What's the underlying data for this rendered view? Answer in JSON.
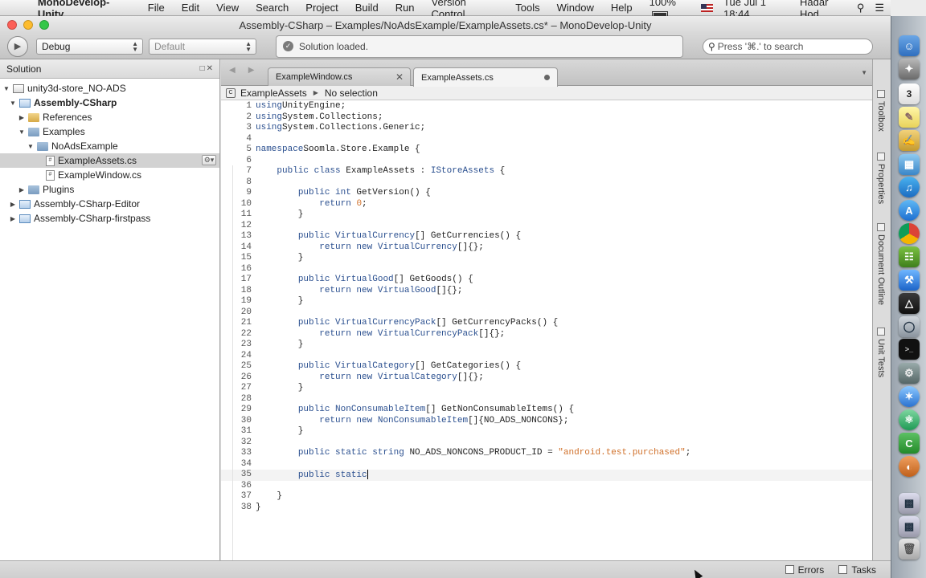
{
  "menubar": {
    "apple_glyph": "",
    "app_name": "MonoDevelop-Unity",
    "menus": [
      "File",
      "Edit",
      "View",
      "Search",
      "Project",
      "Build",
      "Run",
      "Version Control",
      "Tools",
      "Window",
      "Help"
    ],
    "battery": "100%",
    "datetime": "Tue Jul 1  18:44",
    "user": "Hadar Hod"
  },
  "window": {
    "title": "Assembly-CSharp – Examples/NoAdsExample/ExampleAssets.cs* – MonoDevelop-Unity"
  },
  "toolbar": {
    "configuration": "Debug",
    "platform": "Default",
    "status": "Solution loaded.",
    "search_placeholder": "Press '⌘.' to search"
  },
  "solution": {
    "header": "Solution",
    "items": [
      {
        "label": "unity3d-store_NO-ADS",
        "icon": "solution-icon"
      },
      {
        "label": "Assembly-CSharp",
        "icon": "project-icon"
      },
      {
        "label": "References",
        "icon": "references-icon"
      },
      {
        "label": "Examples",
        "icon": "folder-icon"
      },
      {
        "label": "NoAdsExample",
        "icon": "folder-icon"
      },
      {
        "label": "ExampleAssets.cs",
        "icon": "cs-file-icon"
      },
      {
        "label": "ExampleWindow.cs",
        "icon": "cs-file-icon"
      },
      {
        "label": "Plugins",
        "icon": "folder-icon"
      },
      {
        "label": "Assembly-CSharp-Editor",
        "icon": "project-icon"
      },
      {
        "label": "Assembly-CSharp-firstpass",
        "icon": "project-icon"
      }
    ]
  },
  "editor": {
    "tabs": [
      {
        "label": "ExampleWindow.cs"
      },
      {
        "label": "ExampleAssets.cs"
      }
    ],
    "breadcrumb": {
      "class_name": "ExampleAssets",
      "member": "No selection"
    }
  },
  "side_pads": [
    "Toolbox",
    "Properties",
    "Document Outline",
    "Unit Tests"
  ],
  "statusbar": {
    "errors": "Errors",
    "tasks": "Tasks"
  },
  "code_lines": [
    [
      [
        "kw",
        "using"
      ],
      [
        "",
        "UnityEngine;"
      ]
    ],
    [
      [
        "kw",
        "using"
      ],
      [
        "",
        "System.Collections;"
      ]
    ],
    [
      [
        "kw",
        "using"
      ],
      [
        "",
        "System.Collections.Generic;"
      ]
    ],
    [],
    [
      [
        "kw",
        "namespace"
      ],
      [
        "",
        "Soomla.Store.Example {"
      ]
    ],
    [],
    [
      [
        "",
        "    "
      ],
      [
        "kw",
        "public class"
      ],
      [
        "",
        " ExampleAssets : "
      ],
      [
        "ty",
        "IStoreAssets"
      ],
      [
        "",
        " {"
      ]
    ],
    [],
    [
      [
        "",
        "        "
      ],
      [
        "kw",
        "public int"
      ],
      [
        "",
        " GetVersion() {"
      ]
    ],
    [
      [
        "",
        "            "
      ],
      [
        "kw",
        "return"
      ],
      [
        "",
        " "
      ],
      [
        "num",
        "0"
      ],
      [
        "",
        ";"
      ]
    ],
    [
      [
        "",
        "        }"
      ]
    ],
    [],
    [
      [
        "",
        "        "
      ],
      [
        "kw",
        "public"
      ],
      [
        "",
        " "
      ],
      [
        "ty",
        "VirtualCurrency"
      ],
      [
        "",
        "[] GetCurrencies() {"
      ]
    ],
    [
      [
        "",
        "            "
      ],
      [
        "kw",
        "return new"
      ],
      [
        "",
        " "
      ],
      [
        "ty",
        "VirtualCurrency"
      ],
      [
        "",
        "[]{};"
      ]
    ],
    [
      [
        "",
        "        }"
      ]
    ],
    [],
    [
      [
        "",
        "        "
      ],
      [
        "kw",
        "public"
      ],
      [
        "",
        " "
      ],
      [
        "ty",
        "VirtualGood"
      ],
      [
        "",
        "[] GetGoods() {"
      ]
    ],
    [
      [
        "",
        "            "
      ],
      [
        "kw",
        "return new"
      ],
      [
        "",
        " "
      ],
      [
        "ty",
        "VirtualGood"
      ],
      [
        "",
        "[]{};"
      ]
    ],
    [
      [
        "",
        "        }"
      ]
    ],
    [],
    [
      [
        "",
        "        "
      ],
      [
        "kw",
        "public"
      ],
      [
        "",
        " "
      ],
      [
        "ty",
        "VirtualCurrencyPack"
      ],
      [
        "",
        "[] GetCurrencyPacks() {"
      ]
    ],
    [
      [
        "",
        "            "
      ],
      [
        "kw",
        "return new"
      ],
      [
        "",
        " "
      ],
      [
        "ty",
        "VirtualCurrencyPack"
      ],
      [
        "",
        "[]{};"
      ]
    ],
    [
      [
        "",
        "        }"
      ]
    ],
    [],
    [
      [
        "",
        "        "
      ],
      [
        "kw",
        "public"
      ],
      [
        "",
        " "
      ],
      [
        "ty",
        "VirtualCategory"
      ],
      [
        "",
        "[] GetCategories() {"
      ]
    ],
    [
      [
        "",
        "            "
      ],
      [
        "kw",
        "return new"
      ],
      [
        "",
        " "
      ],
      [
        "ty",
        "VirtualCategory"
      ],
      [
        "",
        "[]{};"
      ]
    ],
    [
      [
        "",
        "        }"
      ]
    ],
    [],
    [
      [
        "",
        "        "
      ],
      [
        "kw",
        "public"
      ],
      [
        "",
        " "
      ],
      [
        "ty",
        "NonConsumableItem"
      ],
      [
        "",
        "[] GetNonConsumableItems() {"
      ]
    ],
    [
      [
        "",
        "            "
      ],
      [
        "kw",
        "return new"
      ],
      [
        "",
        " "
      ],
      [
        "ty",
        "NonConsumableItem"
      ],
      [
        "",
        "[]{NO_ADS_NONCONS};"
      ]
    ],
    [
      [
        "",
        "        }"
      ]
    ],
    [],
    [
      [
        "",
        "        "
      ],
      [
        "kw",
        "public static string"
      ],
      [
        "",
        " NO_ADS_NONCONS_PRODUCT_ID = "
      ],
      [
        "str",
        "\"android.test.purchased\""
      ],
      [
        "",
        ";"
      ]
    ],
    [],
    [
      [
        "",
        "        "
      ],
      [
        "kw",
        "public static"
      ]
    ],
    [],
    [
      [
        "",
        "    }"
      ]
    ],
    [
      [
        "",
        "}"
      ]
    ]
  ],
  "current_line": 35
}
